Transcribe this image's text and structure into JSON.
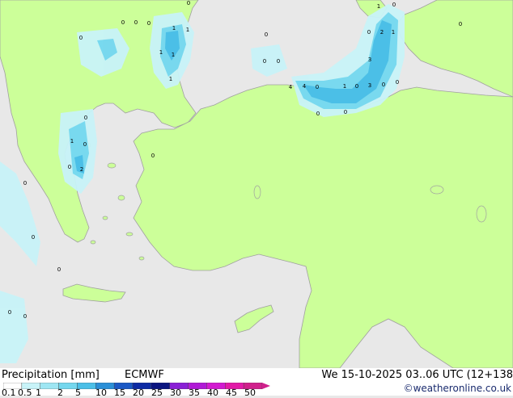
{
  "footer": {
    "legend_title": "Precipitation [mm]",
    "model": "ECMWF",
    "validity": "We 15-10-2025 03..06 UTC (12+138",
    "credit": "©weatheronline.co.uk"
  },
  "legend": {
    "ticks": [
      "0.1",
      "0.5",
      "1",
      "2",
      "5",
      "10",
      "15",
      "20",
      "25",
      "30",
      "35",
      "40",
      "45",
      "50"
    ],
    "colors": [
      "#ffffff",
      "#c8f3f8",
      "#9ee6f3",
      "#74d7ee",
      "#4bbfe7",
      "#2a8fd7",
      "#1a58c5",
      "#0d2aa4",
      "#0b1580",
      "#8a1fd6",
      "#b01ad6",
      "#d21ad0",
      "#e21aa8",
      "#d0208c"
    ]
  },
  "colors": {
    "land": "#ccff99",
    "sea": "#e8e8e8",
    "coast": "#a0a0a0",
    "precip_light": "#c8f3f8",
    "precip_moderate": "#74d7ee",
    "precip_heavy": "#4bbfe7"
  },
  "map_labels": [
    "0",
    "1",
    "1",
    "0",
    "0",
    "1",
    "1",
    "0",
    "0",
    "1",
    "0",
    "0",
    "0",
    "1",
    "2",
    "1",
    "0",
    "3",
    "0",
    "0",
    "1",
    "4",
    "3",
    "0",
    "0",
    "0",
    "0",
    "4",
    "0",
    "0",
    "0",
    "1",
    "0",
    "0",
    "2",
    "0",
    "0",
    "0",
    "0",
    "0",
    "0"
  ]
}
